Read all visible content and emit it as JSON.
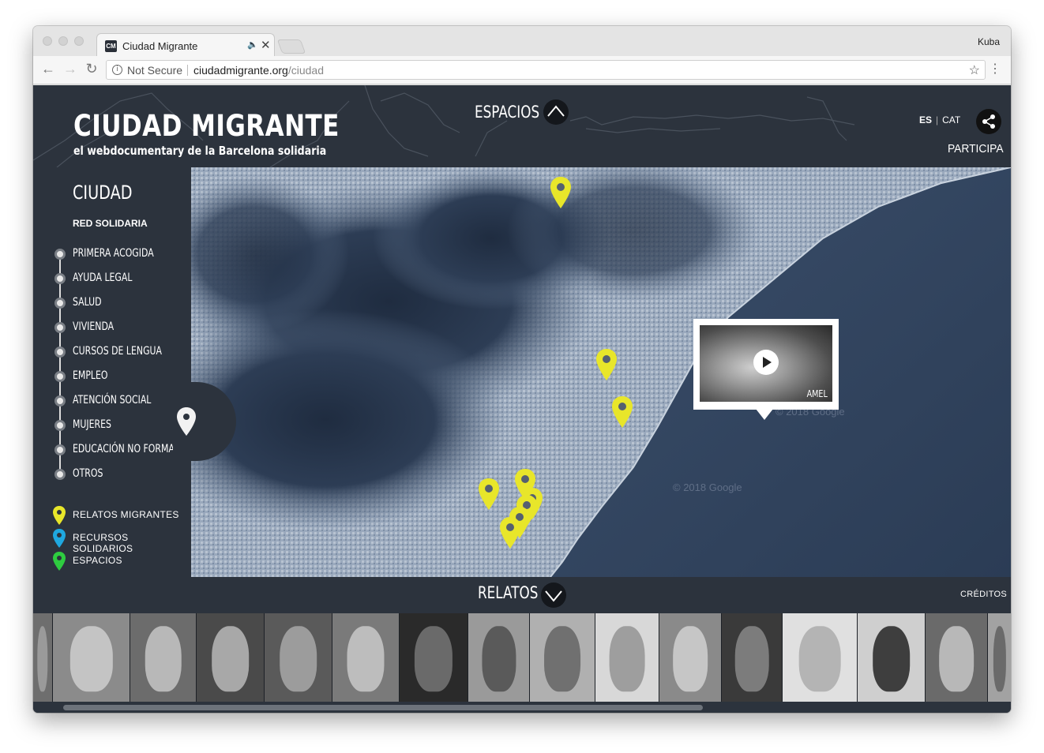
{
  "browser": {
    "tab_title": "Ciudad Migrante",
    "favicon_text": "CM",
    "profile_name": "Kuba",
    "security_label": "Not Secure",
    "url_domain": "ciudadmigrante.org",
    "url_path": "/ciudad"
  },
  "header": {
    "title": "CIUDAD MIGRANTE",
    "subtitle": "el webdocumentary de la Barcelona solidaria",
    "espacios_label": "ESPACIOS",
    "lang_es": "ES",
    "lang_cat": "CAT",
    "participa_label": "PARTICIPA"
  },
  "sidebar": {
    "section_title": "CIUDAD",
    "group_title": "RED SOLIDARIA",
    "categories": [
      "PRIMERA ACOGIDA",
      "AYUDA LEGAL",
      "SALUD",
      "VIVIENDA",
      "CURSOS DE LENGUA",
      "EMPLEO",
      "ATENCIÓN SOCIAL",
      "MUJERES",
      "EDUCACIÓN NO FORMAL",
      "OTROS"
    ],
    "legend": [
      {
        "label": "RELATOS MIGRANTES",
        "color": "#e8e62a"
      },
      {
        "label": "RECURSOS SOLIDARIOS",
        "color": "#1fa8e0"
      },
      {
        "label": "ESPACIOS",
        "color": "#2ecc40"
      }
    ]
  },
  "map": {
    "popup_name": "AMEL",
    "watermark": "© 2018 Google",
    "pin_color": "#e8e62a"
  },
  "bottom": {
    "relatos_label": "RELATOS",
    "creditos_label": "CRÉDITOS"
  },
  "icons": [
    "share-icon",
    "chevron-up-icon",
    "chevron-down-icon",
    "map-pin-icon",
    "play-icon",
    "star-icon",
    "info-icon"
  ]
}
